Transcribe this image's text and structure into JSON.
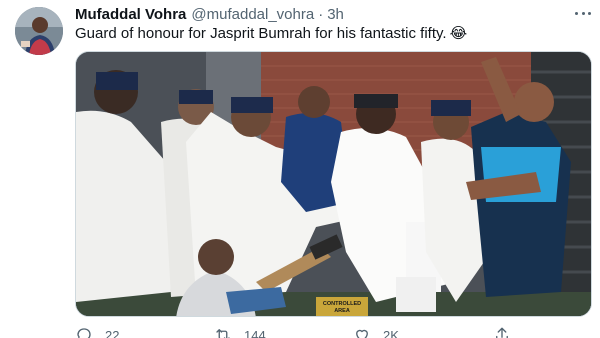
{
  "author": {
    "name": "Mufaddal Vohra",
    "handle": "@mufaddal_vohra",
    "separator": "·",
    "time": "3h"
  },
  "tweet": {
    "text": "Guard of honour for Jasprit Bumrah for his fantastic fifty.",
    "emoji": "😂"
  },
  "media": {
    "sign_text": "CONTROLLED AREA"
  },
  "actions": {
    "replies": "22",
    "retweets": "144",
    "likes": "2K"
  },
  "icons": {
    "more": "more-icon",
    "reply": "reply-icon",
    "retweet": "retweet-icon",
    "like": "heart-icon",
    "share": "share-icon"
  },
  "colors": {
    "text_primary": "#0f1419",
    "text_secondary": "#536471",
    "border": "#cfd9de"
  }
}
